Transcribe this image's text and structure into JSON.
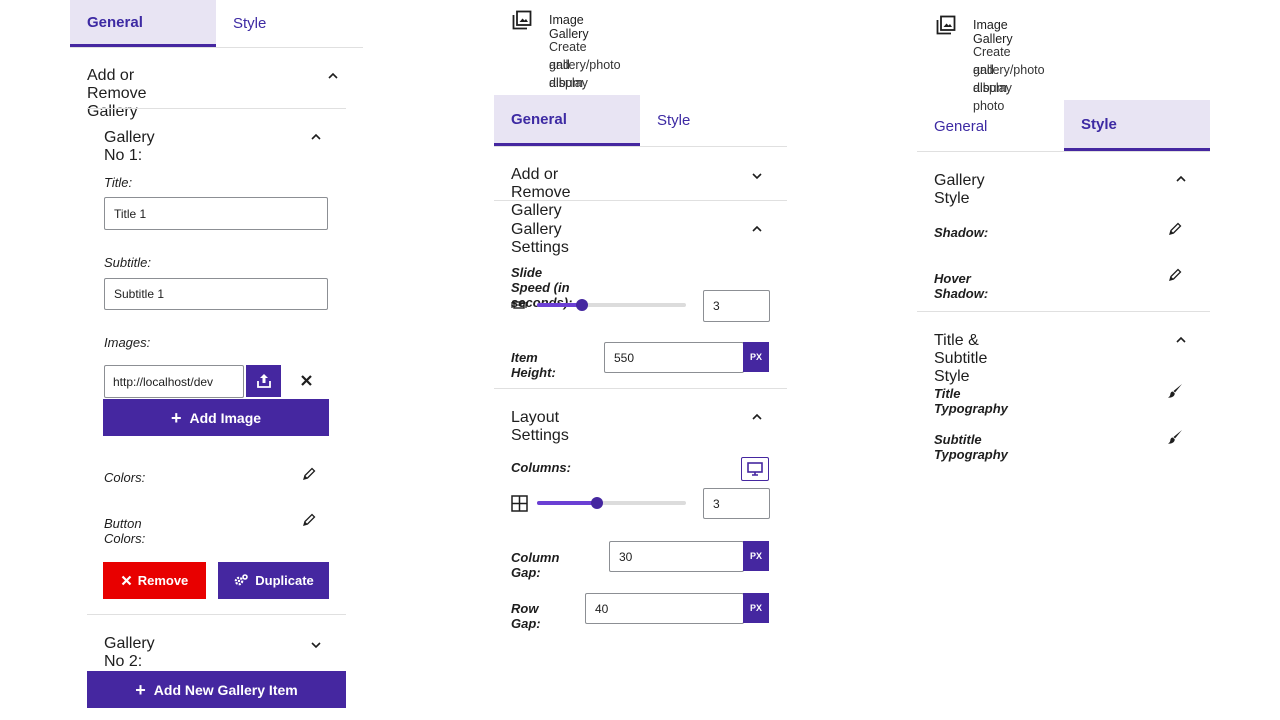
{
  "panel1": {
    "tabs": [
      "General",
      "Style"
    ],
    "section_title": "Add or Remove Gallery",
    "gallery1": {
      "title": "Gallery No 1:",
      "title_label": "Title:",
      "title_value": "Title 1",
      "subtitle_label": "Subtitle:",
      "subtitle_value": "Subtitle 1",
      "images_label": "Images:",
      "image_url": "http://localhost/dev",
      "add_image": "Add Image",
      "colors_label": "Colors:",
      "button_colors_label": "Button Colors:",
      "remove": "Remove",
      "duplicate": "Duplicate"
    },
    "gallery2_title": "Gallery No 2:",
    "add_new_item": "Add New Gallery Item"
  },
  "panel2": {
    "widget_name": "Image Gallery",
    "widget_desc_1": "Create and display photo",
    "widget_desc_2": "gallery/photo album",
    "tabs": [
      "General",
      "Style"
    ],
    "sections": [
      "Add or Remove Gallery",
      "Gallery Settings",
      "Layout Settings"
    ],
    "slide_speed_label": "Slide Speed (in seconds):",
    "slide_speed_value": "3",
    "slide_speed_fraction": 0.3,
    "item_height_label": "Item Height:",
    "item_height_value": "550",
    "unit": "PX",
    "columns_label": "Columns:",
    "columns_value": "3",
    "columns_fraction": 0.4,
    "column_gap_label": "Column Gap:",
    "column_gap_value": "30",
    "row_gap_label": "Row Gap:",
    "row_gap_value": "40"
  },
  "panel3": {
    "widget_name": "Image Gallery",
    "widget_desc_1": "Create and display photo",
    "widget_desc_2": "gallery/photo album",
    "tabs": [
      "General",
      "Style"
    ],
    "gallery_style": "Gallery Style",
    "shadow_label": "Shadow:",
    "hover_shadow_label": "Hover Shadow:",
    "title_subtitle_style": "Title & Subtitle Style",
    "title_typography": "Title Typography",
    "subtitle_typography": "Subtitle Typography"
  },
  "colors": {
    "accent": "#4527a0",
    "tab_bg": "#e8e4f3",
    "danger": "#e80000"
  }
}
